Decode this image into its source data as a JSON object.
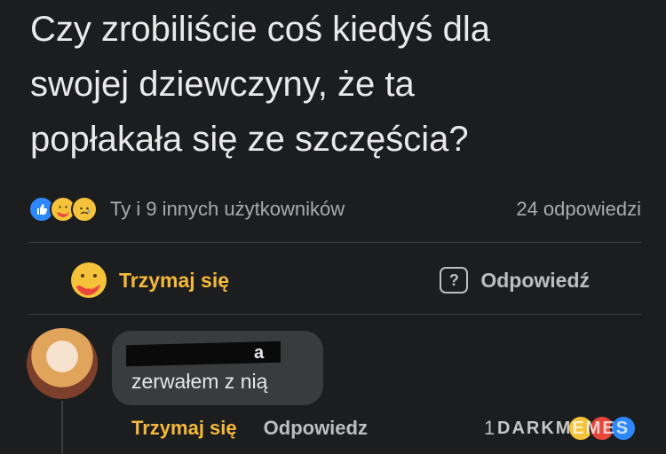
{
  "post": {
    "lines": [
      "Czy zrobiliście coś kiedyś dla",
      "swojej dziewczyny, że ta",
      "popłakała się ze szczęścia?"
    ]
  },
  "stats": {
    "reaction_icons": [
      "like-icon",
      "care-icon",
      "sad-icon"
    ],
    "reactors_text": "Ty i 9 innych użytkowników",
    "replies_count": "24 odpowiedzi"
  },
  "actions": {
    "care_label": "Trzymaj się",
    "reply_label": "Odpowiedź"
  },
  "comment": {
    "author_visible": "a",
    "text": "zerwałem z nią",
    "care_label": "Trzymaj się",
    "reply_label": "Odpowiedz",
    "reactions_count": "1"
  },
  "watermark": "DARKMEMES",
  "colors": {
    "background": "#1c1d1f",
    "care_accent": "#f5b93a",
    "like_blue": "#2d88ff"
  }
}
